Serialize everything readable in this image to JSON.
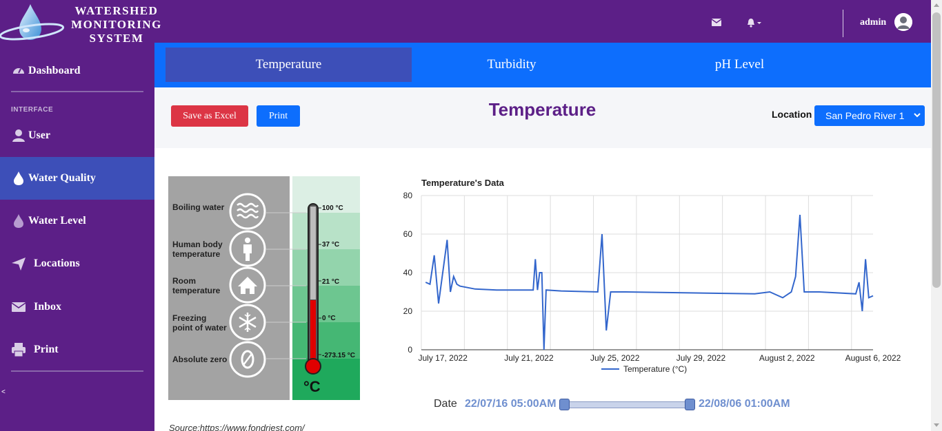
{
  "app": {
    "title_lines": [
      "WATERSHED",
      "MONITORING",
      "SYSTEM"
    ],
    "user_name": "admin"
  },
  "topbar": {
    "mail_icon": "envelope-icon",
    "bell_icon": "bell-icon",
    "user_icon": "user-circle-icon"
  },
  "sidebar": {
    "heading": "INTERFACE",
    "toggle": "<",
    "items": [
      {
        "label": "Dashboard",
        "icon": "gauge-icon"
      },
      {
        "label": "User",
        "icon": "user-icon"
      },
      {
        "label": "Water Quality",
        "icon": "water-drop-icon"
      },
      {
        "label": "Water Level",
        "icon": "water-drop-icon"
      },
      {
        "label": "Locations",
        "icon": "paper-plane-icon"
      },
      {
        "label": "Inbox",
        "icon": "envelope-icon"
      },
      {
        "label": "Print",
        "icon": "printer-icon"
      }
    ]
  },
  "tabs": [
    {
      "label": "Temperature",
      "active": true
    },
    {
      "label": "Turbidity",
      "active": false
    },
    {
      "label": "pH Level",
      "active": false
    }
  ],
  "controls": {
    "save_label": "Save as Excel",
    "print_label": "Print",
    "page_title": "Temperature",
    "location_label": "Location",
    "location_value": "San Pedro River 1"
  },
  "thermometer": {
    "rows": [
      {
        "label": "Boiling water",
        "value": "100 °C",
        "icon": "waves-icon"
      },
      {
        "label": "Human body temperature",
        "value": "37 °C",
        "icon": "person-icon"
      },
      {
        "label": "Room temperature",
        "value": "21 °C",
        "icon": "house-icon"
      },
      {
        "label": "Freezing point of water",
        "value": "0 °C",
        "icon": "snowflake-icon"
      },
      {
        "label": "Absolute zero",
        "value": "-273.15 °C",
        "icon": "zero-icon"
      }
    ],
    "unit": "°C",
    "source": "Source:https://www.fondriest.com/"
  },
  "chart_data": {
    "type": "line",
    "title": "Temperature's Data",
    "x_tick_labels": [
      "July 17, 2022",
      "July 21, 2022",
      "July 25, 2022",
      "July 29, 2022",
      "August 2, 2022",
      "August 6, 2022"
    ],
    "y_ticks": [
      0,
      20,
      40,
      60,
      80
    ],
    "ylim": [
      0,
      80
    ],
    "xlim": [
      "2022-07-16",
      "2022-08-06"
    ],
    "grid": true,
    "legend": "bottom",
    "series": [
      {
        "name": "Temperature (°C)",
        "color": "#3366cc",
        "x": [
          "2022-07-16",
          "2022-07-16",
          "2022-07-16",
          "2022-07-16",
          "2022-07-17",
          "2022-07-17",
          "2022-07-17",
          "2022-07-17",
          "2022-07-17",
          "2022-07-18",
          "2022-07-19",
          "2022-07-21",
          "2022-07-21",
          "2022-07-21",
          "2022-07-21",
          "2022-07-21",
          "2022-07-21",
          "2022-07-21",
          "2022-07-22",
          "2022-07-24",
          "2022-07-24",
          "2022-07-24",
          "2022-07-24",
          "2022-07-25",
          "2022-07-28",
          "2022-07-31",
          "2022-08-01",
          "2022-08-01",
          "2022-08-02",
          "2022-08-02",
          "2022-08-02",
          "2022-08-02",
          "2022-08-03",
          "2022-08-05",
          "2022-08-05",
          "2022-08-05",
          "2022-08-05",
          "2022-08-05",
          "2022-08-06"
        ],
        "y": [
          35,
          34,
          49,
          24,
          57,
          30,
          38,
          34,
          33,
          31.5,
          31,
          31,
          47,
          31,
          40,
          40,
          0,
          31,
          30.5,
          30,
          60,
          10,
          30,
          30,
          29.5,
          29,
          30,
          27,
          30,
          38,
          70,
          30,
          30,
          29,
          35,
          20,
          47,
          27,
          28
        ]
      }
    ]
  },
  "date_range": {
    "label": "Date",
    "start": "22/07/16 05:00AM",
    "end": "22/08/06 01:00AM"
  }
}
